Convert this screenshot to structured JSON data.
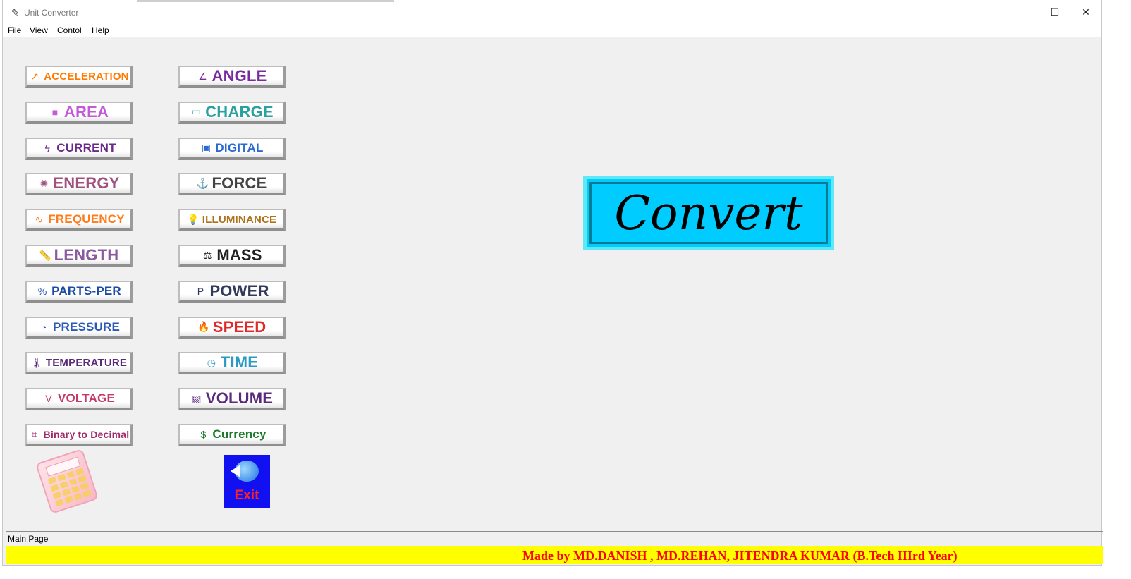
{
  "window": {
    "title": "Unit Converter",
    "controls": {
      "minimize": "—",
      "maximize": "☐",
      "close": "✕"
    }
  },
  "menu": [
    "File",
    "View",
    "Contol",
    "Help"
  ],
  "left_buttons": [
    {
      "label": "ACCELERATION",
      "icon": "accel-icon",
      "glyph": "↗",
      "color": "#ff7a00"
    },
    {
      "label": "AREA",
      "icon": "area-icon",
      "glyph": "■",
      "color": "#c45ad9"
    },
    {
      "label": "CURRENT",
      "icon": "current-icon",
      "glyph": "ϟ",
      "color": "#6a2a8a"
    },
    {
      "label": "ENERGY",
      "icon": "energy-icon",
      "glyph": "✺",
      "color": "#a0527f"
    },
    {
      "label": "FREQUENCY",
      "icon": "frequency-icon",
      "glyph": "∿",
      "color": "#ff7a1a"
    },
    {
      "label": "LENGTH",
      "icon": "ruler-icon",
      "glyph": "📏",
      "color": "#8a5aa0"
    },
    {
      "label": "PARTS-PER",
      "icon": "parts-per-icon",
      "glyph": "%",
      "color": "#1b4aa8"
    },
    {
      "label": "PRESSURE",
      "icon": "gauge-icon",
      "glyph": "◔",
      "color": "#2a58b8"
    },
    {
      "label": "TEMPERATURE",
      "icon": "thermometer-icon",
      "glyph": "🌡",
      "color": "#5a2a7a"
    },
    {
      "label": "VOLTAGE",
      "icon": "voltage-icon",
      "glyph": "V",
      "color": "#c4386a"
    },
    {
      "label": "Binary to Decimal",
      "icon": "binary-icon",
      "glyph": "⌗",
      "color": "#a02a6a"
    }
  ],
  "right_buttons": [
    {
      "label": "ANGLE",
      "icon": "angle-icon",
      "glyph": "∠",
      "color": "#7a2aa0"
    },
    {
      "label": "CHARGE",
      "icon": "battery-icon",
      "glyph": "▭",
      "color": "#2aa0a0"
    },
    {
      "label": "DIGITAL",
      "icon": "digital-icon",
      "glyph": "▣",
      "color": "#2a6ad0"
    },
    {
      "label": "FORCE",
      "icon": "force-icon",
      "glyph": "⚓",
      "color": "#444444"
    },
    {
      "label": "ILLUMINANCE",
      "icon": "bulb-icon",
      "glyph": "💡",
      "color": "#b0701a"
    },
    {
      "label": "MASS",
      "icon": "weight-icon",
      "glyph": "⚖",
      "color": "#222222"
    },
    {
      "label": "POWER",
      "icon": "power-icon",
      "glyph": "P",
      "color": "#333a5a"
    },
    {
      "label": "SPEED",
      "icon": "speed-icon",
      "glyph": "🔥",
      "color": "#e02a2a"
    },
    {
      "label": "TIME",
      "icon": "clock-icon",
      "glyph": "◷",
      "color": "#2a9ac4"
    },
    {
      "label": "VOLUME",
      "icon": "cube-icon",
      "glyph": "▧",
      "color": "#5a2a7a"
    },
    {
      "label": "Currency",
      "icon": "currency-icon",
      "glyph": "$",
      "color": "#1a7a2a"
    }
  ],
  "convert_label": "Convert",
  "exit_label": "Exit",
  "status": "Main Page",
  "credit": "Made by MD.DANISH , MD.REHAN, JITENDRA KUMAR (B.Tech IIIrd Year)"
}
